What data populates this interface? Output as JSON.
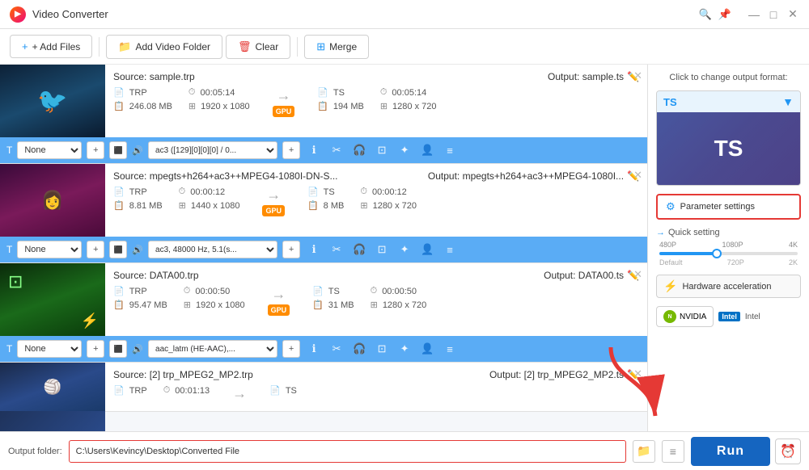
{
  "titleBar": {
    "appName": "Video Converter",
    "controls": {
      "minimize": "—",
      "maximize": "□",
      "close": "✕"
    }
  },
  "toolbar": {
    "addFiles": "+ Add Files",
    "addFolder": "Add Video Folder",
    "clear": "Clear",
    "merge": "Merge"
  },
  "rightPanel": {
    "hint": "Click to change output format:",
    "format": "TS",
    "paramSettings": "Parameter settings",
    "quickSetting": "Quick setting",
    "hwAccel": "Hardware acceleration",
    "nvidia": "NVIDIA",
    "intel": "Intel",
    "qualityLabels": [
      "480P",
      "1080P",
      "4K"
    ],
    "qualitySubLabels": [
      "Default",
      "720P",
      "2K"
    ]
  },
  "files": [
    {
      "id": 1,
      "source": "Source: sample.trp",
      "output": "Output: sample.ts",
      "sourceFormat": "TRP",
      "sourceTime": "00:05:14",
      "sourceSize": "246.08 MB",
      "sourceRes": "1920 x 1080",
      "outputFormat": "TS",
      "outputTime": "00:05:14",
      "outputSize": "194 MB",
      "outputRes": "1280 x 720",
      "audio": "ac3 ([129][0][0][0] / 0...",
      "thumbClass": "thumb1"
    },
    {
      "id": 2,
      "source": "Source: mpegts+h264+ac3++MPEG4-1080I-DN-S...",
      "output": "Output: mpegts+h264+ac3++MPEG4-1080I...",
      "sourceFormat": "TRP",
      "sourceTime": "00:00:12",
      "sourceSize": "8.81 MB",
      "sourceRes": "1440 x 1080",
      "outputFormat": "TS",
      "outputTime": "00:00:12",
      "outputSize": "8 MB",
      "outputRes": "1280 x 720",
      "audio": "ac3, 48000 Hz, 5.1(s...",
      "thumbClass": "thumb2"
    },
    {
      "id": 3,
      "source": "Source: DATA00.trp",
      "output": "Output: DATA00.ts",
      "sourceFormat": "TRP",
      "sourceTime": "00:00:50",
      "sourceSize": "95.47 MB",
      "sourceRes": "1920 x 1080",
      "outputFormat": "TS",
      "outputTime": "00:00:50",
      "outputSize": "31 MB",
      "outputRes": "1280 x 720",
      "audio": "aac_latm (HE-AAC),...",
      "thumbClass": "thumb3"
    },
    {
      "id": 4,
      "source": "Source: [2] trp_MPEG2_MP2.trp",
      "output": "Output: [2] trp_MPEG2_MP2.ts",
      "sourceFormat": "TRP",
      "sourceTime": "00:01:13",
      "sourceSize": "",
      "sourceRes": "",
      "outputFormat": "TS",
      "outputTime": "",
      "outputSize": "",
      "outputRes": "",
      "audio": "",
      "thumbClass": "thumb4"
    }
  ],
  "bottomBar": {
    "outputLabel": "Output folder:",
    "outputPath": "C:\\Users\\Kevincy\\Desktop\\Converted File",
    "runBtn": "Run"
  }
}
